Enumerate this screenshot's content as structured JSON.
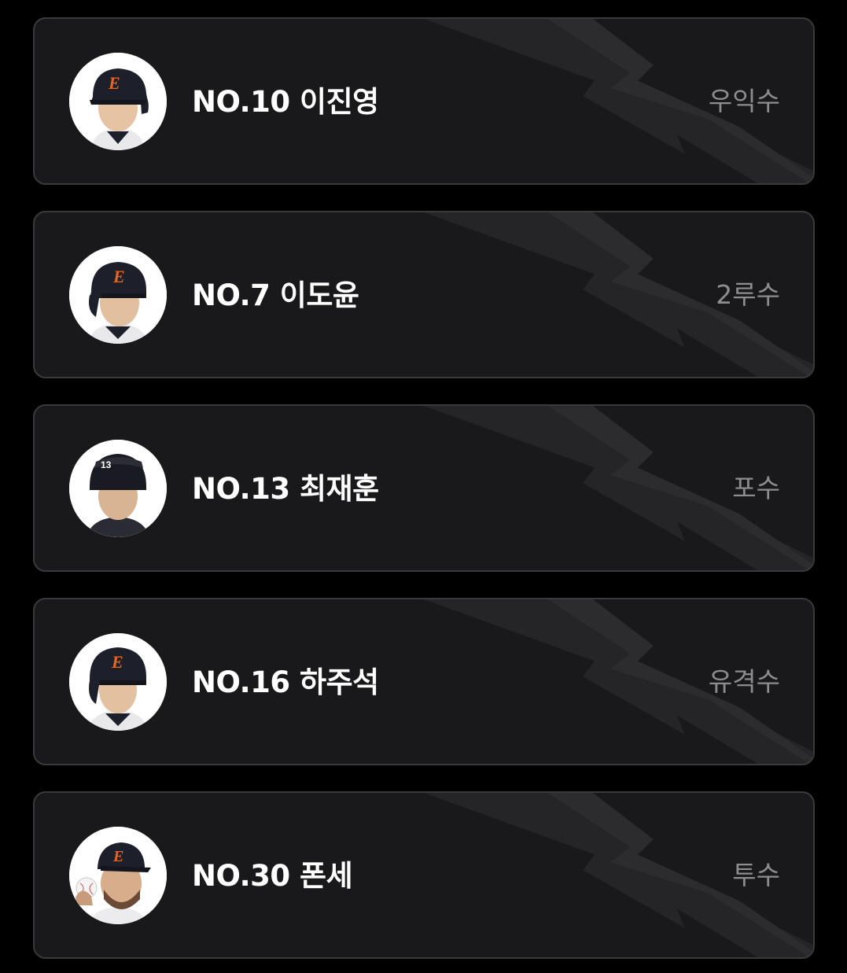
{
  "players": [
    {
      "name": "NO.10 이진영",
      "position": "우익수",
      "avatar": "player-photo-helmet-e-logo"
    },
    {
      "name": "NO.7 이도윤",
      "position": "2루수",
      "avatar": "player-photo-helmet-e-logo"
    },
    {
      "name": "NO.13 최재훈",
      "position": "포수",
      "avatar": "player-photo-catcher-helmet"
    },
    {
      "name": "NO.16 하주석",
      "position": "유격수",
      "avatar": "player-photo-helmet-e-logo"
    },
    {
      "name": "NO.30 폰세",
      "position": "투수",
      "avatar": "player-photo-cap-with-ball"
    }
  ],
  "colors": {
    "background": "#000000",
    "card": "#19191b",
    "card_border": "#3a3a3d",
    "name_text": "#ffffff",
    "position_text": "#8d8d90",
    "helmet": "#1d1f2b",
    "logo_orange": "#e8651e"
  }
}
